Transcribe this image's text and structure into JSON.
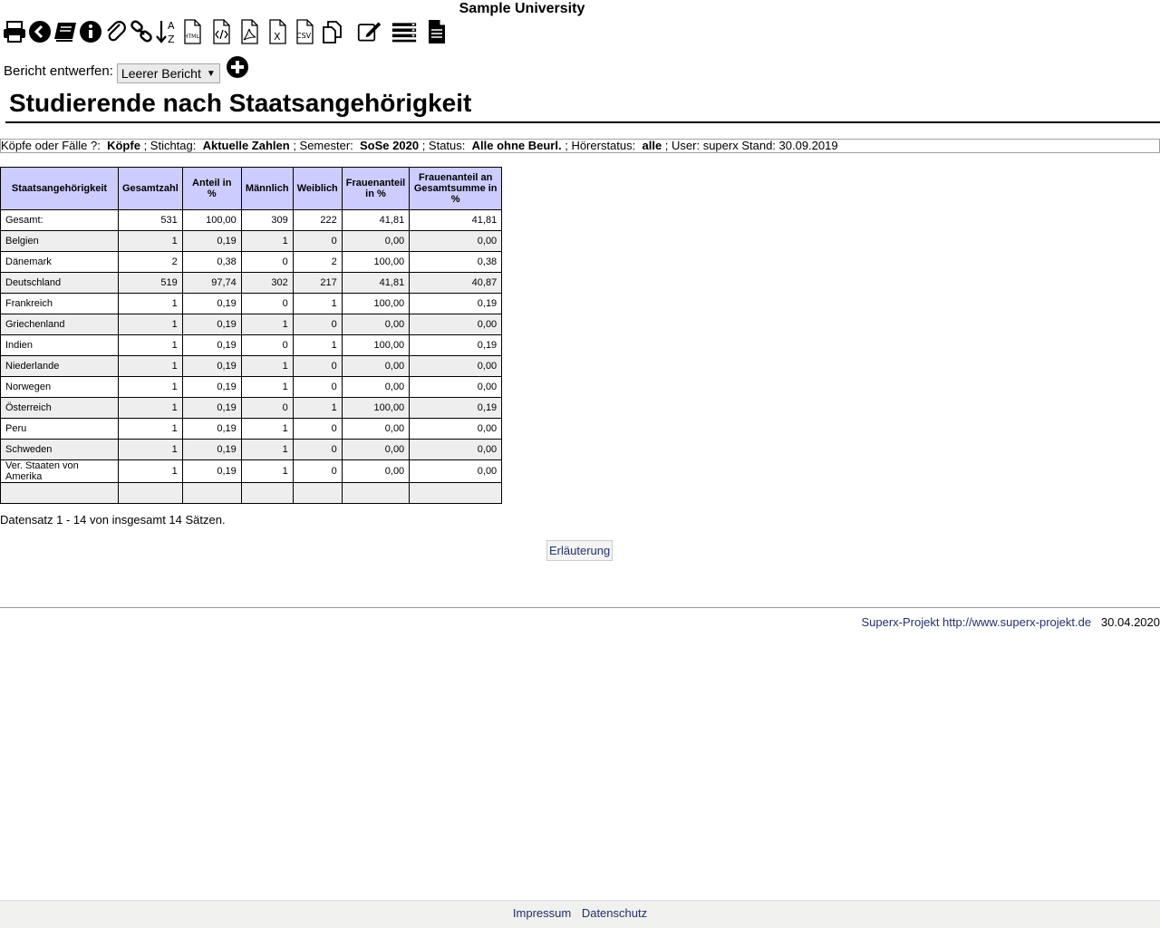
{
  "header": {
    "title": "Sample University"
  },
  "toolbar": {
    "items": [
      {
        "name": "print-icon"
      },
      {
        "name": "back-icon"
      },
      {
        "name": "book-icon"
      },
      {
        "name": "info-icon"
      },
      {
        "name": "paperclip-icon"
      },
      {
        "name": "link-icon"
      },
      {
        "name": "sort-az-icon",
        "text": "A Z"
      },
      {
        "name": "html-export-icon",
        "text": "HTML"
      },
      {
        "name": "code-export-icon",
        "text": "</>"
      },
      {
        "name": "pdf-export-icon"
      },
      {
        "name": "excel-export-icon",
        "text": "X"
      },
      {
        "name": "csv-export-icon",
        "text": "CSV"
      },
      {
        "name": "copy-icon"
      },
      {
        "name": "edit-icon"
      },
      {
        "name": "list-icon"
      },
      {
        "name": "document-icon"
      }
    ]
  },
  "report_design": {
    "label": "Bericht entwerfen:",
    "selected": "Leerer Bericht"
  },
  "page_title": "Studierende nach Staatsangehörigkeit",
  "params": {
    "koepfe_label": "Köpfe oder Fälle ?:",
    "koepfe_value": "Köpfe",
    "stichtag_label": "; Stichtag:",
    "stichtag_value": "Aktuelle Zahlen",
    "semester_label": "; Semester:",
    "semester_value": "SoSe 2020",
    "status_label": "; Status:",
    "status_value": "Alle ohne Beurl.",
    "hoerer_label": "; Hörerstatus:",
    "hoerer_value": "alle",
    "user_stand": "; User: superx  Stand: 30.09.2019"
  },
  "table": {
    "columns": [
      "Staatsangehörigkeit",
      "Gesamtzahl",
      "Anteil in %",
      "Männlich",
      "Weiblich",
      "Frauenanteil in %",
      "Frauenanteil an Gesamtsumme in %"
    ],
    "rows": [
      [
        "Gesamt:",
        "531",
        "100,00",
        "309",
        "222",
        "41,81",
        "41,81"
      ],
      [
        "Belgien",
        "1",
        "0,19",
        "1",
        "0",
        "0,00",
        "0,00"
      ],
      [
        "Dänemark",
        "2",
        "0,38",
        "0",
        "2",
        "100,00",
        "0,38"
      ],
      [
        "Deutschland",
        "519",
        "97,74",
        "302",
        "217",
        "41,81",
        "40,87"
      ],
      [
        "Frankreich",
        "1",
        "0,19",
        "0",
        "1",
        "100,00",
        "0,19"
      ],
      [
        "Griechenland",
        "1",
        "0,19",
        "1",
        "0",
        "0,00",
        "0,00"
      ],
      [
        "Indien",
        "1",
        "0,19",
        "0",
        "1",
        "100,00",
        "0,19"
      ],
      [
        "Niederlande",
        "1",
        "0,19",
        "1",
        "0",
        "0,00",
        "0,00"
      ],
      [
        "Norwegen",
        "1",
        "0,19",
        "1",
        "0",
        "0,00",
        "0,00"
      ],
      [
        "Österreich",
        "1",
        "0,19",
        "0",
        "1",
        "100,00",
        "0,19"
      ],
      [
        "Peru",
        "1",
        "0,19",
        "1",
        "0",
        "0,00",
        "0,00"
      ],
      [
        "Schweden",
        "1",
        "0,19",
        "1",
        "0",
        "0,00",
        "0,00"
      ],
      [
        "Ver. Staaten von Amerika",
        "1",
        "0,19",
        "1",
        "0",
        "0,00",
        "0,00"
      ],
      [
        "",
        "",
        "",
        "",
        "",
        "",
        ""
      ]
    ]
  },
  "record_count": "Datensatz 1 - 14 von insgesamt 14 Sätzen.",
  "explanation_button": "Erläuterung",
  "footer": {
    "project_link": "Superx-Projekt http://www.superx-projekt.de",
    "date": "30.04.2020"
  },
  "bottom_bar": {
    "impressum": "Impressum",
    "datenschutz": "Datenschutz"
  },
  "colors": {
    "header_bg": "#ccccff",
    "alt_row": "#eeeeee",
    "link": "#23306b"
  }
}
